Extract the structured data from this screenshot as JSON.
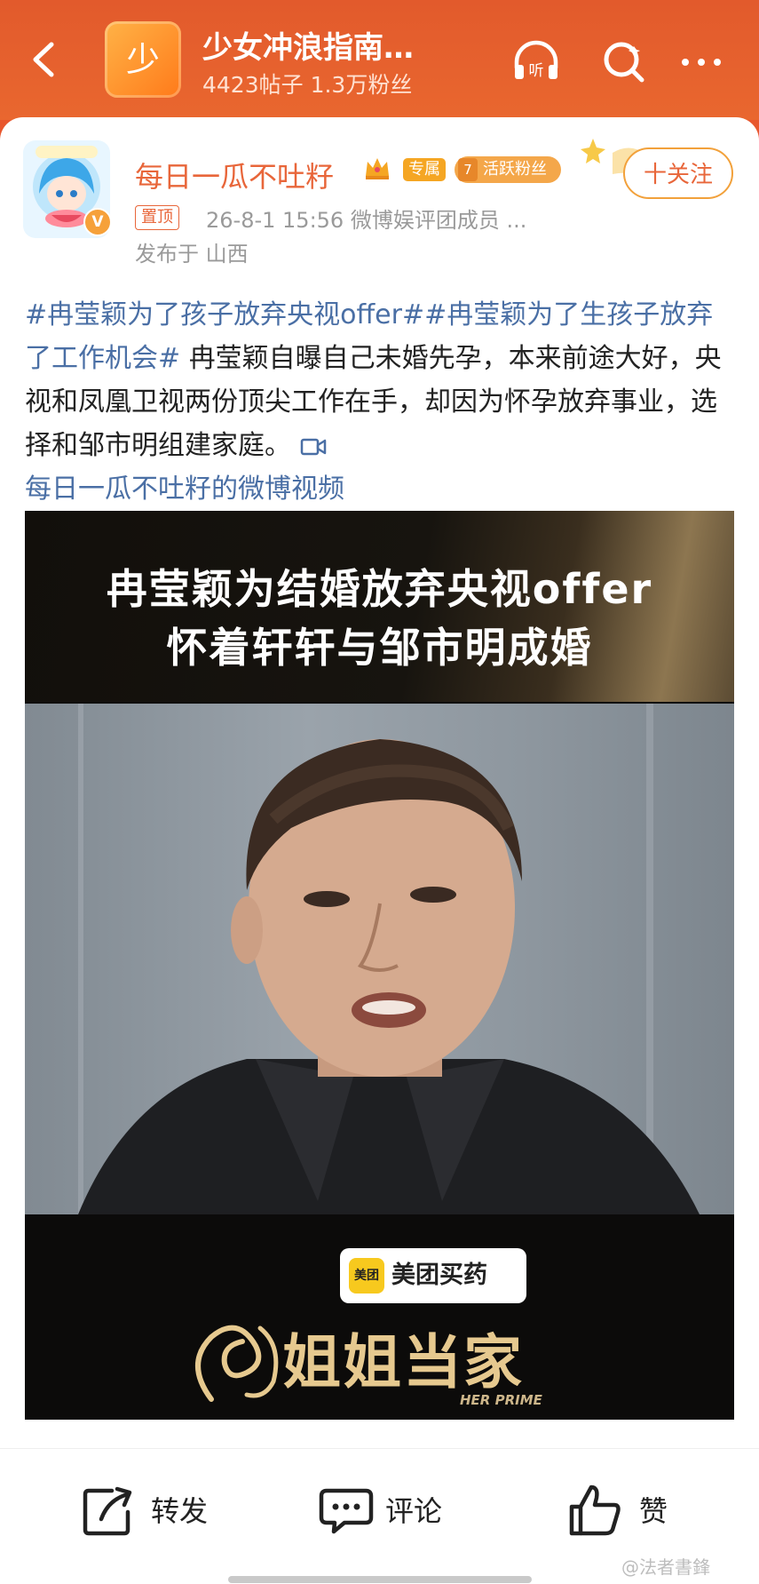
{
  "header": {
    "avatar_char": "少",
    "title": "少女冲浪指南…",
    "subtitle": "4423帖子 1.3万粉丝",
    "icons": [
      "back-arrow-icon",
      "listen-headphone-icon",
      "search-icon",
      "more-dots-icon"
    ],
    "listen_label": "听"
  },
  "post": {
    "author": "每日一瓜不吐籽",
    "badge_exclusive": "专属",
    "fan_level": "7",
    "fan_badge": "活跃粉丝",
    "follow_label": "十关注",
    "pin_label": "置顶",
    "meta": "26-8-1 15:56  微博娱评团成员 ...",
    "location": "发布于 山西",
    "tag1": "#冉莹颖为了孩子放弃央视offer#",
    "tag2": "#冉莹颖为了生孩子放弃了工作机会#",
    "body": "冉莹颖自曝自己未婚先孕，本来前途大好，央视和凤凰卫视两份顶尖工作在手，却因为怀孕放弃事业，选择和邹市明组建家庭。",
    "video_link": "每日一瓜不吐籽的微博视频"
  },
  "video": {
    "caption_line1": "冉莹颖为结婚放弃央视offer",
    "caption_line2": "怀着轩轩与邹市明成婚",
    "sponsor_logo": "美团",
    "sponsor": "美团买药",
    "show_title": "姐姐当家",
    "show_subtitle": "HER PRIME"
  },
  "actions": {
    "repost": "转发",
    "comment": "评论",
    "like": "赞"
  },
  "watermark": "@法者書鋒",
  "colors": {
    "header_bg": "#e25a2c",
    "accent": "#e8663a",
    "link": "#4a6fa5"
  }
}
